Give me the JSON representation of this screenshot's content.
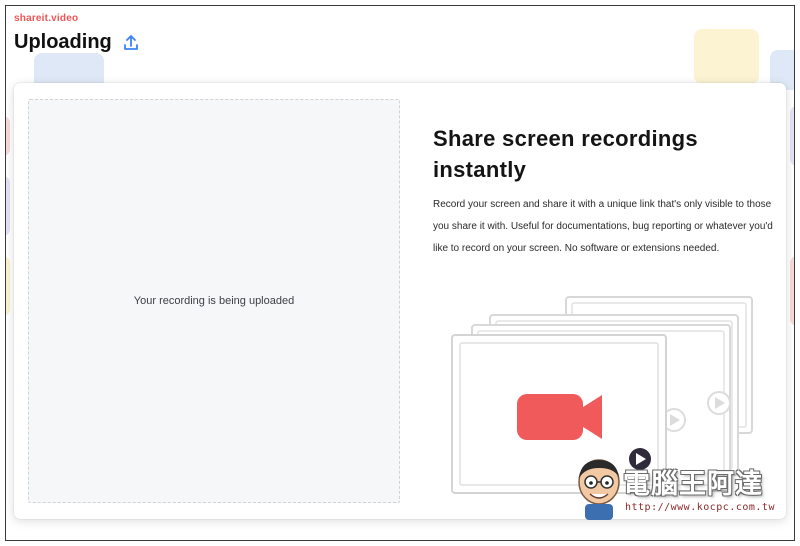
{
  "header": {
    "brand": "shareit.video",
    "title": "Uploading"
  },
  "upload_panel": {
    "status_text": "Your recording is being uploaded"
  },
  "info": {
    "headline": "Share screen recordings instantly",
    "description": "Record your screen and share it with a unique link that's only visible to those you share it with. Useful for documentations, bug reporting or whatever you'd like to record on your screen. No software or extensions needed."
  },
  "watermark": {
    "text": "電腦王阿達",
    "url": "http://www.kocpc.com.tw"
  },
  "colors": {
    "brand_red": "#f05454",
    "accent_blue": "#3b82f6",
    "camera_red": "#f05a5a",
    "play_dark": "#2f2b3a"
  },
  "icons": {
    "upload": "upload-icon",
    "camera": "video-camera-icon",
    "play": "play-icon"
  }
}
